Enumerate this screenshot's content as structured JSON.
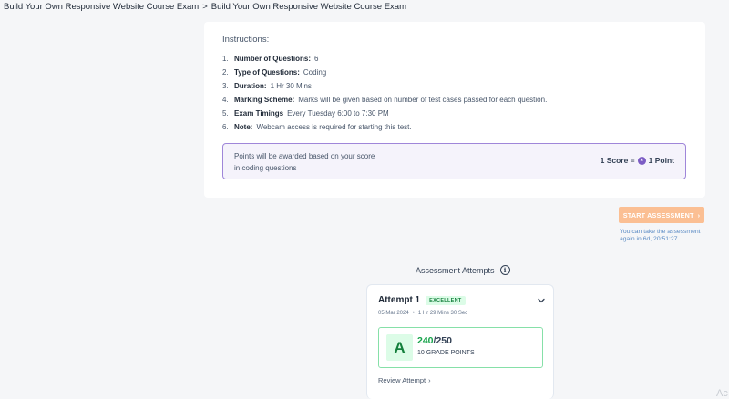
{
  "breadcrumb": {
    "items": [
      "Build Your Own Responsive Website Course Exam",
      "Build Your Own Responsive Website Course Exam"
    ],
    "separator": ">"
  },
  "instructions": {
    "title": "Instructions:",
    "items": [
      {
        "num": "1.",
        "label": "Number of Questions:",
        "value": "6"
      },
      {
        "num": "2.",
        "label": "Type of Questions:",
        "value": "Coding"
      },
      {
        "num": "3.",
        "label": "Duration:",
        "value": "1 Hr 30 Mins"
      },
      {
        "num": "4.",
        "label": "Marking Scheme:",
        "value": "Marks will be given based on number of test cases passed for each question."
      },
      {
        "num": "5.",
        "label": "Exam Timings",
        "value": "Every Tuesday 6:00 to 7:30 PM"
      },
      {
        "num": "6.",
        "label": "Note:",
        "value": "Webcam access is required for starting this test."
      }
    ]
  },
  "points": {
    "description": "Points will be awarded based on your score in coding questions",
    "score_left": "1 Score =",
    "score_right": "1 Point"
  },
  "start": {
    "label": "START ASSESSMENT",
    "chevron": "›",
    "note": "You can take the assessment again in 6d, 20:51:27"
  },
  "attempts": {
    "title": "Assessment Attempts",
    "info_glyph": "i",
    "items": [
      {
        "label": "Attempt 1",
        "badge": "EXCELLENT",
        "date": "05 Mar 2024",
        "dot": "•",
        "duration": "1 Hr 29 Mins 30 Sec",
        "grade": "A",
        "score": "240",
        "total": "/250",
        "grade_points": "10 GRADE POINTS",
        "review_label": "Review Attempt",
        "review_chevron": "›"
      }
    ]
  },
  "watermark": "Ac",
  "colors": {
    "accent_purple": "#7c5cc4",
    "start_button": "#fbbf93",
    "success_green": "#16a34a",
    "link_blue": "#5b8bc4"
  }
}
